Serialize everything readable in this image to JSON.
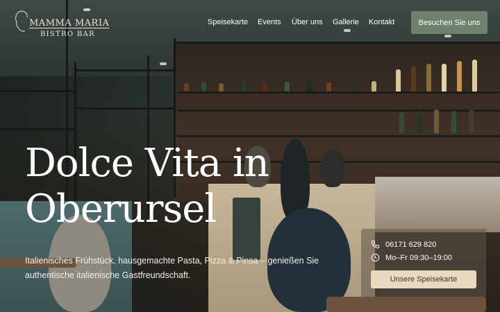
{
  "brand": {
    "name": "MAMMA MARIA",
    "subtitle": "BISTRO BAR"
  },
  "nav": {
    "items": [
      {
        "label": "Speisekarte"
      },
      {
        "label": "Events"
      },
      {
        "label": "Über uns"
      },
      {
        "label": "Gallerie"
      },
      {
        "label": "Kontakt"
      }
    ],
    "cta_label": "Besuchen Sie uns"
  },
  "hero": {
    "headline_line1": "Dolce Vita in",
    "headline_line2": "Oberursel",
    "tagline_line1": "Italienisches Frühstück, hausgemachte Pasta, Pizza & Pinsa – genießen Sie",
    "tagline_line2": "authentische italienische Gastfreundschaft."
  },
  "info_card": {
    "phone": "06171 629 820",
    "hours": "Mo–Fr 09:30–19:00",
    "button_label": "Unsere Speisekarte",
    "phone_icon": "phone-icon",
    "clock_icon": "clock-icon"
  },
  "colors": {
    "cta_green": "#6f826d",
    "menu_button": "#e8d9bf",
    "text": "#ffffff"
  }
}
